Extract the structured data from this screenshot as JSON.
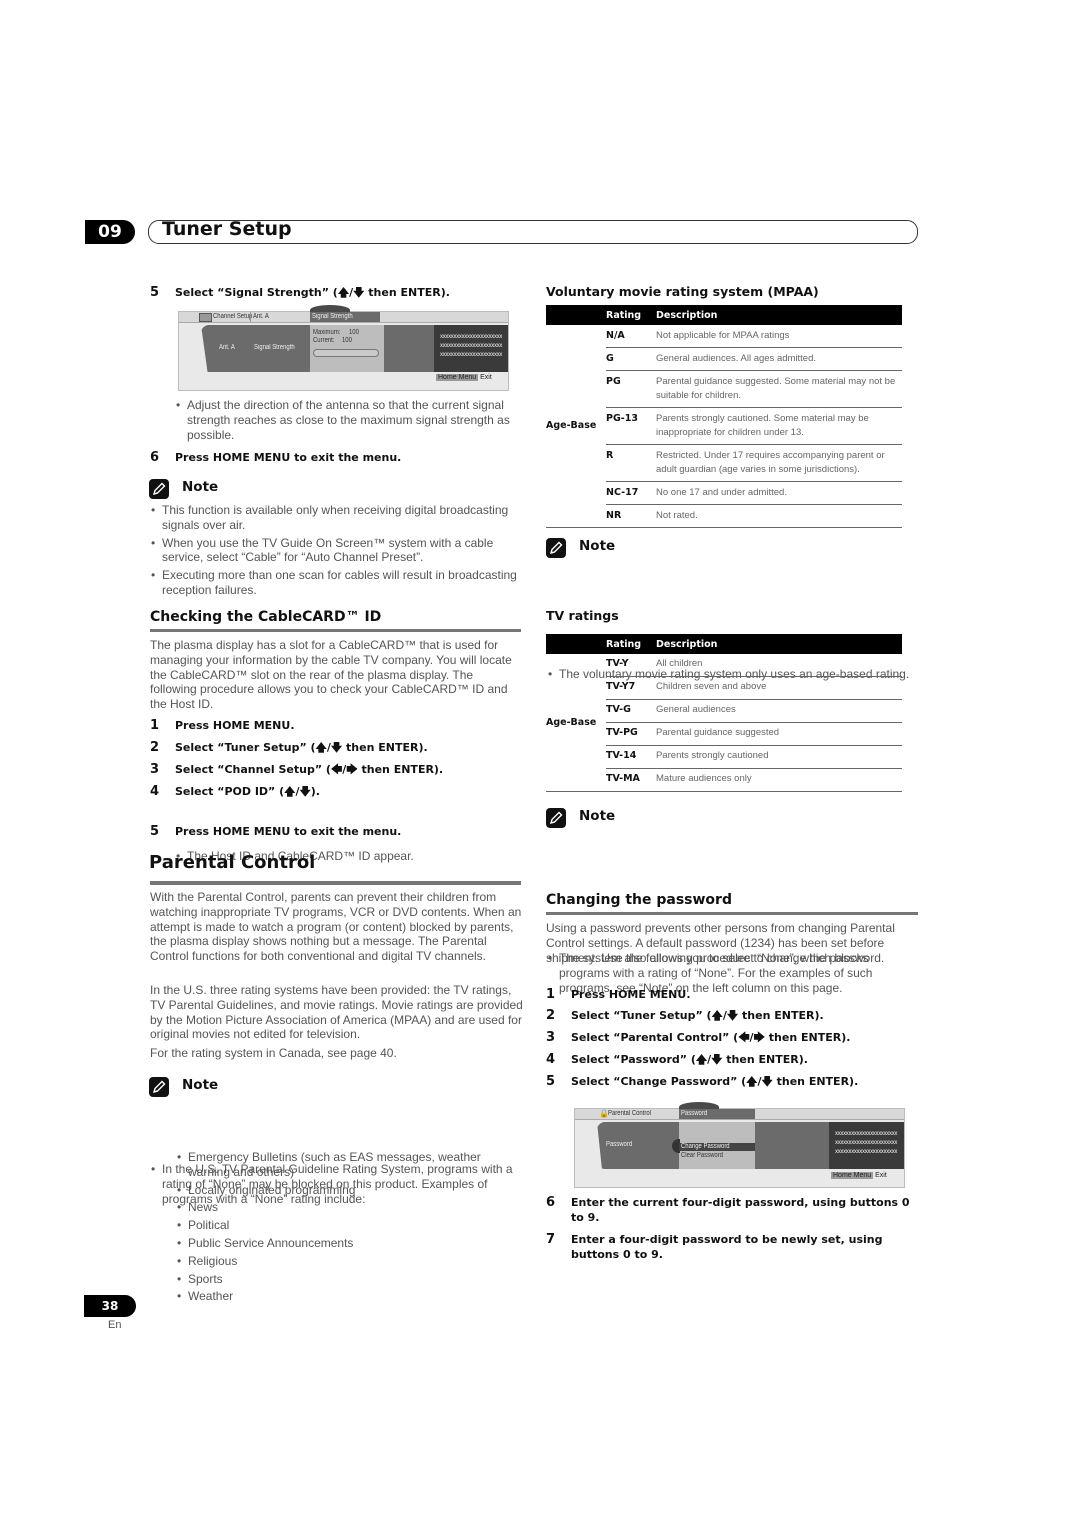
{
  "header": {
    "chapter_number": "09",
    "chapter_title": "Tuner Setup"
  },
  "left": {
    "step5": {
      "num": "5",
      "text": "Select “Signal Strength” (🡅/🡇 then ENTER)."
    },
    "signal_screen": {
      "breadcrumb_icon": "channel-setup-icon",
      "breadcrumb_1": "Channel Setup",
      "breadcrumb_2": "Ant. A",
      "active_tab": "Signal Strength",
      "panel_label_1": "Ant. A",
      "panel_label_2": "Signal Strength",
      "maximum_label": "Maximum:",
      "maximum_value": "100",
      "current_label": "Current:",
      "current_value": "100",
      "info_lines": [
        "xxxxxxxxxxxxxxxxxxxxxxx",
        "xxxxxxxxxxxxxxxxxxxxxxx",
        "xxxxxxxxxxxxxxxxxxxxxxx"
      ],
      "home_menu_key": "Home Menu",
      "exit_label": "Exit"
    },
    "step5_bullet": "Adjust the direction of the antenna so that the current signal strength reaches as close to the maximum signal strength as possible.",
    "step6": {
      "num": "6",
      "text": "Press HOME MENU to exit the menu."
    },
    "note1": {
      "label": "Note",
      "items": [
        "This function is available only when receiving digital broadcasting signals over air.",
        "When you use the TV Guide On Screen™ system with a cable service, select “Cable” for “Auto Channel Preset”.",
        "Executing more than one scan for cables will result in broadcasting reception failures."
      ]
    },
    "cablecard": {
      "title": "Checking the CableCARD™ ID",
      "intro": "The plasma display has a slot for a CableCARD™ that is used for managing your information by the cable TV company. You will locate the CableCARD™ slot on the rear of the plasma display. The following procedure allows you to check your CableCARD™ ID and the Host ID.",
      "steps": [
        {
          "num": "1",
          "text": "Press HOME MENU."
        },
        {
          "num": "2",
          "text": "Select “Tuner Setup” (🡅/🡇 then ENTER)."
        },
        {
          "num": "3",
          "text": "Select “Channel Setup” (🡄/🡆 then ENTER)."
        },
        {
          "num": "4",
          "text": "Select “POD ID” (🡅/🡇)."
        }
      ],
      "step4_bullet": "The Host ID and CableCARD™ ID appear.",
      "step5": {
        "num": "5",
        "text": "Press HOME MENU to exit the menu."
      }
    },
    "parental": {
      "title": "Parental Control",
      "para1": "With the Parental Control, parents can prevent their children from watching inappropriate TV programs, VCR or DVD contents. When an attempt is made to watch a program (or content) blocked by parents, the plasma display shows nothing but a message. The Parental Control functions for both conventional and digital TV channels.",
      "para2": "In the U.S. three rating systems have been provided: the TV ratings, TV Parental Guidelines, and movie ratings. Movie ratings are provided by the Motion Picture Association of America (MPAA) and are used for original movies not edited for television.",
      "para3": "For the rating system in Canada, see page 40."
    },
    "note2": {
      "label": "Note",
      "intro": "In the U.S. TV Parental Guideline Rating System, programs with a rating of “None” may be blocked on this product. Examples of programs with a “None” rating include:",
      "items": [
        "Emergency Bulletins (such as EAS messages, weather warning and others)",
        "Locally originated programming",
        "News",
        "Political",
        "Public Service Announcements",
        "Religious",
        "Sports",
        "Weather"
      ]
    }
  },
  "right": {
    "mpaa": {
      "title": "Voluntary movie rating system (MPAA)",
      "columns": [
        "Rating",
        "Description"
      ],
      "group_label": "Age-Base",
      "rows": [
        {
          "rating": "N/A",
          "description": "Not applicable for MPAA ratings"
        },
        {
          "rating": "G",
          "description": "General audiences. All ages admitted."
        },
        {
          "rating": "PG",
          "description": "Parental guidance suggested. Some material may not be suitable for children."
        },
        {
          "rating": "PG-13",
          "description": "Parents strongly cautioned. Some material may be inappropriate for children under 13."
        },
        {
          "rating": "R",
          "description": "Restricted. Under 17 requires accompanying parent or adult guardian (age varies in some jurisdictions)."
        },
        {
          "rating": "NC-17",
          "description": "No one 17 and under admitted."
        },
        {
          "rating": "NR",
          "description": "Not rated."
        }
      ]
    },
    "note3": {
      "label": "Note",
      "items": [
        "The voluntary movie rating system only uses an age-based rating."
      ]
    },
    "tv": {
      "title": "TV ratings",
      "columns": [
        "Rating",
        "Description"
      ],
      "group_label": "Age-Base",
      "rows": [
        {
          "rating": "TV-Y",
          "description": "All children"
        },
        {
          "rating": "TV-Y7",
          "description": "Children seven and above"
        },
        {
          "rating": "TV-G",
          "description": "General audiences"
        },
        {
          "rating": "TV-PG",
          "description": "Parental guidance suggested"
        },
        {
          "rating": "TV-14",
          "description": "Parents strongly cautioned"
        },
        {
          "rating": "TV-MA",
          "description": "Mature audiences only"
        }
      ]
    },
    "note4": {
      "label": "Note",
      "items": [
        "The system also allows you to select “None”, which blocks programs with a rating of “None”. For the examples of such programs, see “Note” on the left column on this page."
      ]
    },
    "password": {
      "title": "Changing the password",
      "intro": "Using a password prevents other persons from changing Parental Control settings. A default password (1234) has been set before shipment. Use the following procedure to change the password.",
      "steps": [
        {
          "num": "1",
          "text": "Press HOME MENU."
        },
        {
          "num": "2",
          "text": "Select “Tuner Setup” (🡅/🡇 then ENTER)."
        },
        {
          "num": "3",
          "text": "Select “Parental Control” (🡄/🡆 then ENTER)."
        },
        {
          "num": "4",
          "text": "Select “Password” (🡅/🡇 then ENTER)."
        },
        {
          "num": "5",
          "text": "Select “Change Password” (🡅/🡇 then ENTER)."
        }
      ],
      "screen": {
        "breadcrumb_icon": "lock-icon",
        "breadcrumb_1": "Parental Control",
        "active_tab": "Password",
        "panel_label": "Password",
        "options": [
          "Change Password",
          "Clear Password"
        ],
        "selected_option": "Change Password",
        "info_lines": [
          "xxxxxxxxxxxxxxxxxxxxxxx",
          "xxxxxxxxxxxxxxxxxxxxxxx",
          "xxxxxxxxxxxxxxxxxxxxxxx"
        ],
        "home_menu_key": "Home Menu",
        "exit_label": "Exit"
      },
      "step6": {
        "num": "6",
        "text_line1": "Enter the current four-digit password, using buttons 0",
        "text_line2": "to 9."
      },
      "step7": {
        "num": "7",
        "text_line1": "Enter a four-digit password to be newly set, using",
        "text_line2": "buttons 0 to 9."
      }
    }
  },
  "footer": {
    "page_number": "38",
    "language": "En"
  }
}
